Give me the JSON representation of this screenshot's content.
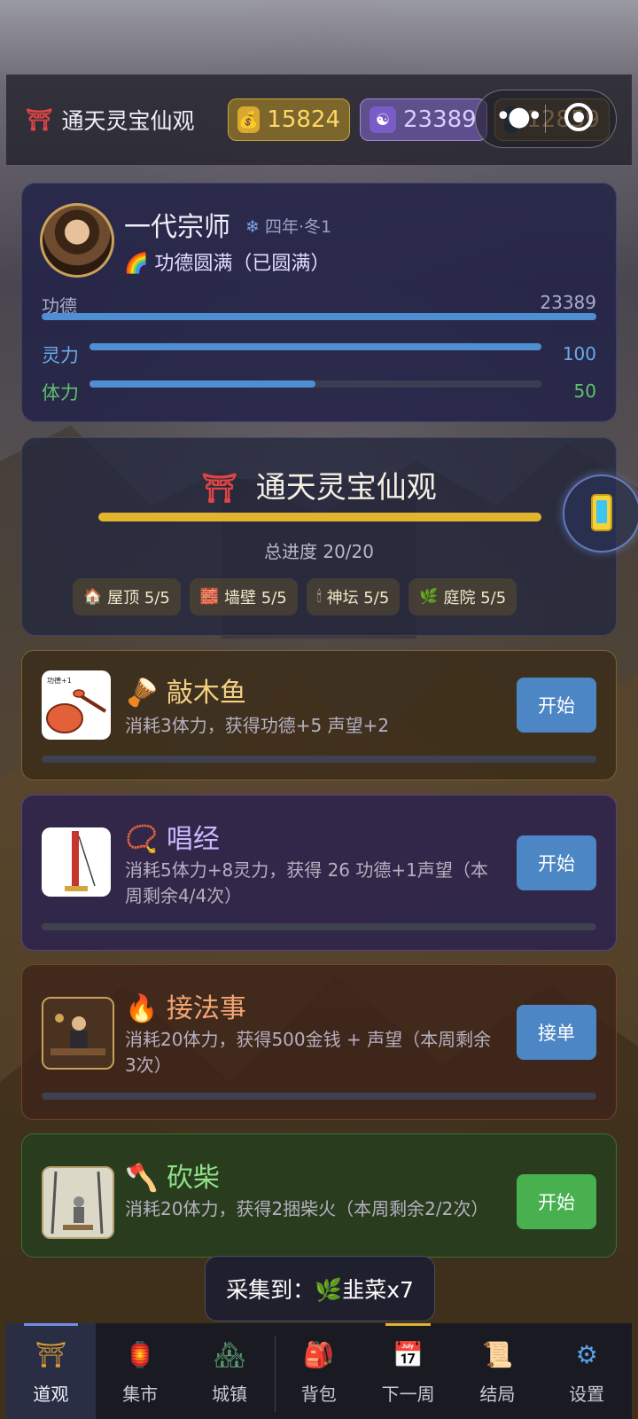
{
  "header": {
    "title": "通天灵宝仙观",
    "gold": "15824",
    "spirit": "23389",
    "third": "12859"
  },
  "profile": {
    "name": "一代宗师",
    "season": "四年·冬1",
    "status": "功德圆满（已圆满）",
    "merit_label": "功德",
    "merit_value": "23389",
    "merit_fill": 1.0,
    "ling_label": "灵力",
    "ling_value": "100",
    "ling_fill": 1.0,
    "ti_label": "体力",
    "ti_value": "50",
    "ti_fill": 0.5
  },
  "temple": {
    "title": "通天灵宝仙观",
    "progress": "总进度 20/20",
    "parts": [
      {
        "label": "屋顶 5/5",
        "icon": "house-icon"
      },
      {
        "label": "墙壁 5/5",
        "icon": "brick-icon"
      },
      {
        "label": "神坛 5/5",
        "icon": "candle-icon"
      },
      {
        "label": "庭院 5/5",
        "icon": "herb-icon"
      }
    ]
  },
  "tasks": [
    {
      "name": "敲木鱼",
      "desc": "消耗3体力，获得功德+5 声望+2",
      "button": "开始",
      "thumb_label": "功德+1"
    },
    {
      "name": "唱经",
      "desc": "消耗5体力+8灵力，获得 26 功德+1声望（本周剩余4/4次）",
      "button": "开始"
    },
    {
      "name": "接法事",
      "desc": "消耗20体力，获得500金钱 + 声望（本周剩余3次）",
      "button": "接单"
    },
    {
      "name": "砍柴",
      "desc": "消耗20体力，获得2捆柴火（本周剩余2/2次）",
      "button": "开始"
    }
  ],
  "toast": "采集到：🌿韭菜x7",
  "nav": [
    {
      "label": "道观",
      "icon": "temple-icon"
    },
    {
      "label": "集市",
      "icon": "market-icon"
    },
    {
      "label": "城镇",
      "icon": "town-icon"
    },
    {
      "label": "背包",
      "icon": "backpack-icon"
    },
    {
      "label": "下一周",
      "icon": "calendar-icon"
    },
    {
      "label": "结局",
      "icon": "scroll-icon"
    },
    {
      "label": "设置",
      "icon": "gear-icon"
    }
  ],
  "colors": {
    "accent_blue": "#4d86c4",
    "accent_green": "#48b04f",
    "gold": "#e3b52e"
  }
}
